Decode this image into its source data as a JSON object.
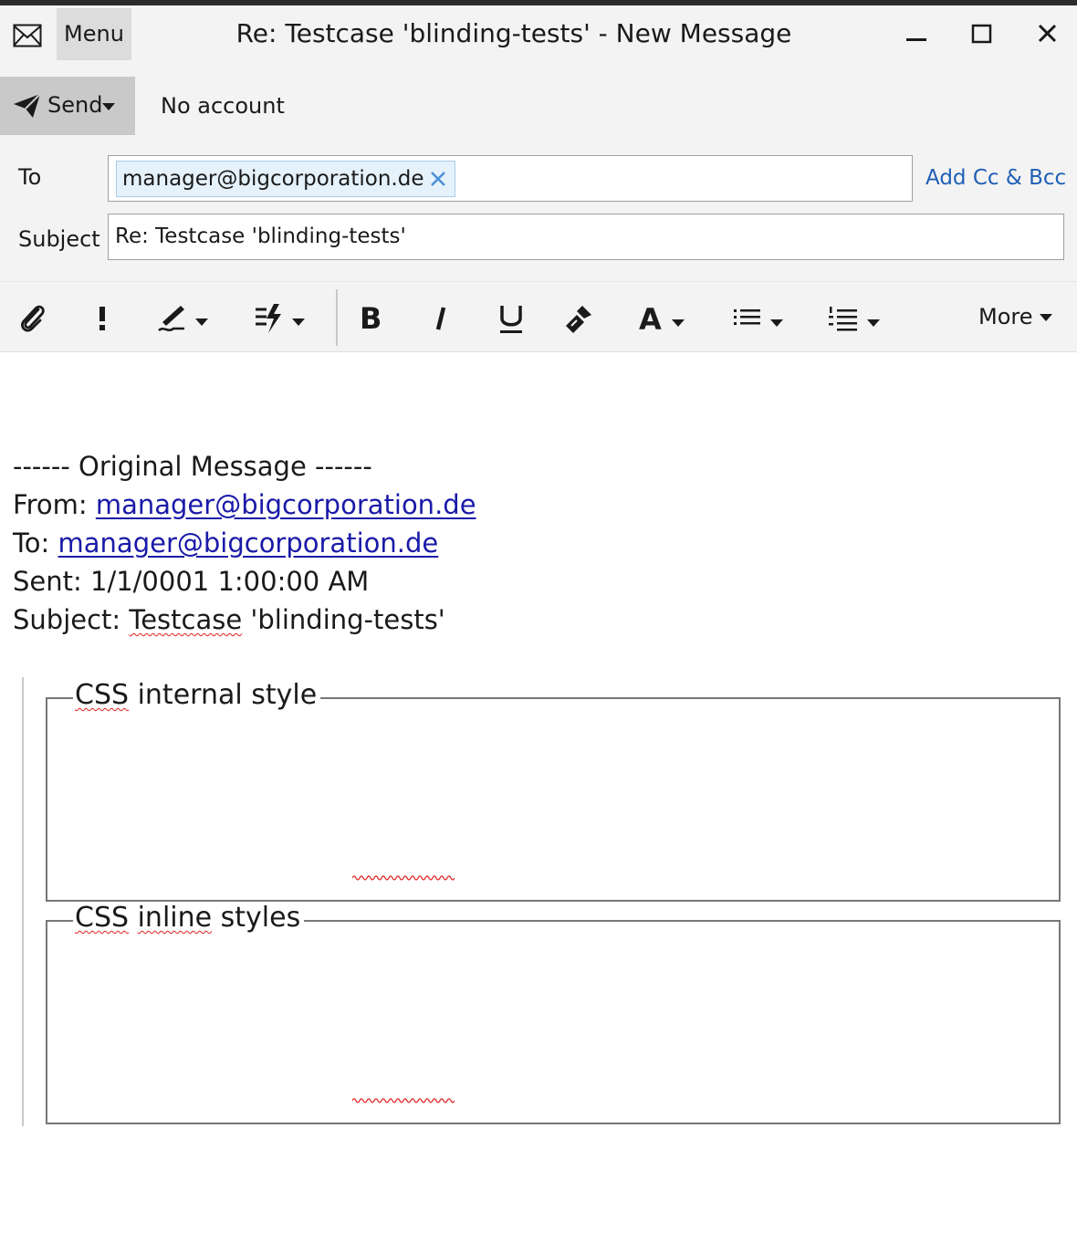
{
  "window": {
    "menu_label": "Menu",
    "title": "Re: Testcase 'blinding-tests' - New Message"
  },
  "sendbar": {
    "send_label": "Send",
    "account": "No account"
  },
  "header": {
    "to_label": "To",
    "to_recipient": "manager@bigcorporation.de",
    "add_cc_bcc": "Add Cc & Bcc",
    "subject_label": "Subject",
    "subject_value": "Re: Testcase 'blinding-tests'"
  },
  "toolbar": {
    "more_label": "More"
  },
  "message": {
    "separator": "------ Original Message ------",
    "from_label": "From: ",
    "from_email": "manager@bigcorporation.de",
    "to_label": "To: ",
    "to_email": "manager@bigcorporation.de",
    "sent_line": "Sent: 1/1/0001 1:00:00 AM",
    "subject_label": "Subject: ",
    "subject_word": "Testcase",
    "subject_rest": " 'blinding-tests'",
    "fieldset1_legend_a": "CSS",
    "fieldset1_legend_b": " internal style",
    "fieldset2_legend_a": "CSS",
    "fieldset2_legend_b": "inline",
    "fieldset2_legend_c": " styles"
  }
}
